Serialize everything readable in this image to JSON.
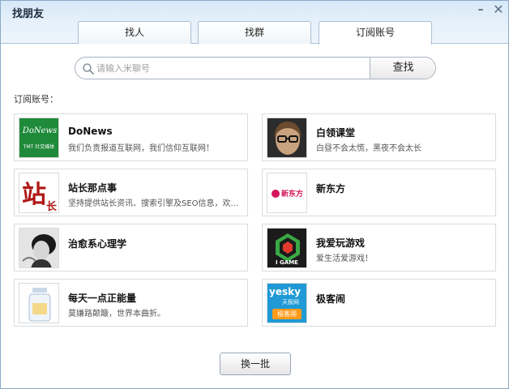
{
  "window": {
    "title": "找朋友",
    "minimize": "–",
    "close": "✕"
  },
  "tabs": [
    {
      "label": "找人",
      "active": false
    },
    {
      "label": "找群",
      "active": false
    },
    {
      "label": "订阅账号",
      "active": true
    }
  ],
  "search": {
    "placeholder": "请输入米聊号",
    "value": "",
    "button_label": "查找",
    "icon": "search-icon"
  },
  "section_label": "订阅账号：",
  "accounts": [
    {
      "name": "DoNews",
      "desc": "我们负责报道互联网，我们信仰互联网！",
      "logo_text": "DoNews",
      "logo_sub": "TMT 社交媒体"
    },
    {
      "name": "白领课堂",
      "desc": "白昼不会太慌，黑夜不会太长",
      "logo_text": ""
    },
    {
      "name": "站长那点事",
      "desc": "坚持提供站长资讯、搜索引擎及SEO信息，欢...",
      "logo_text": "站",
      "logo_sub": "长"
    },
    {
      "name": "新东方",
      "desc": "",
      "logo_text": "新东方"
    },
    {
      "name": "治愈系心理学",
      "desc": "",
      "logo_text": ""
    },
    {
      "name": "我爱玩游戏",
      "desc": "爱生活爱游戏！",
      "logo_text": "I GAME"
    },
    {
      "name": "每天一点正能量",
      "desc": "莫嫌路颠簸，世界本曲折。",
      "logo_text": ""
    },
    {
      "name": "极客闹",
      "desc": "",
      "logo_text": "yesky",
      "logo_sub": "天极网",
      "logo_sub2": "极客闹"
    }
  ],
  "refresh_button": "换一批",
  "colors": {
    "accent": "#8ca9c7",
    "donews_green": "#1f8a3a",
    "game_green": "#3aa845",
    "yesky_blue": "#1f9ad6"
  }
}
